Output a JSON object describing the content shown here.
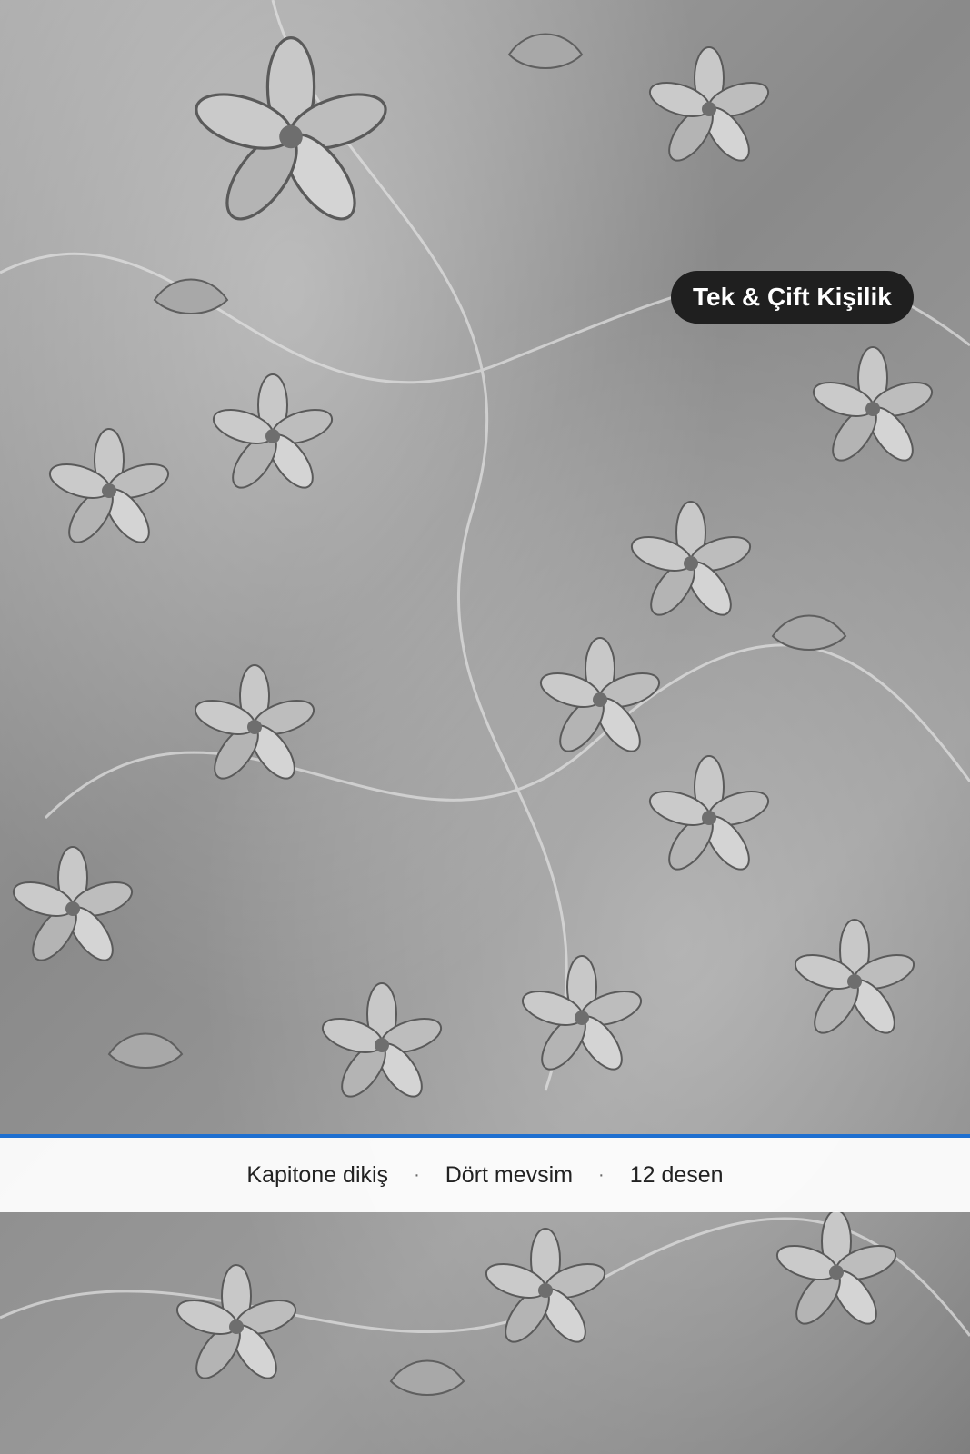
{
  "badge": {
    "label": "Tek & Çift Kişilik"
  },
  "features": {
    "items": [
      "Kapitone dikiş",
      "Dört mevsim",
      "12 desen"
    ],
    "separator": "·"
  },
  "colors": {
    "accent": "#1e6fd0",
    "badge_bg": "#1f1f1f",
    "badge_text": "#ffffff",
    "bar_text": "#222222"
  },
  "image": {
    "subject": "floral-embossed-fabric-texture"
  }
}
